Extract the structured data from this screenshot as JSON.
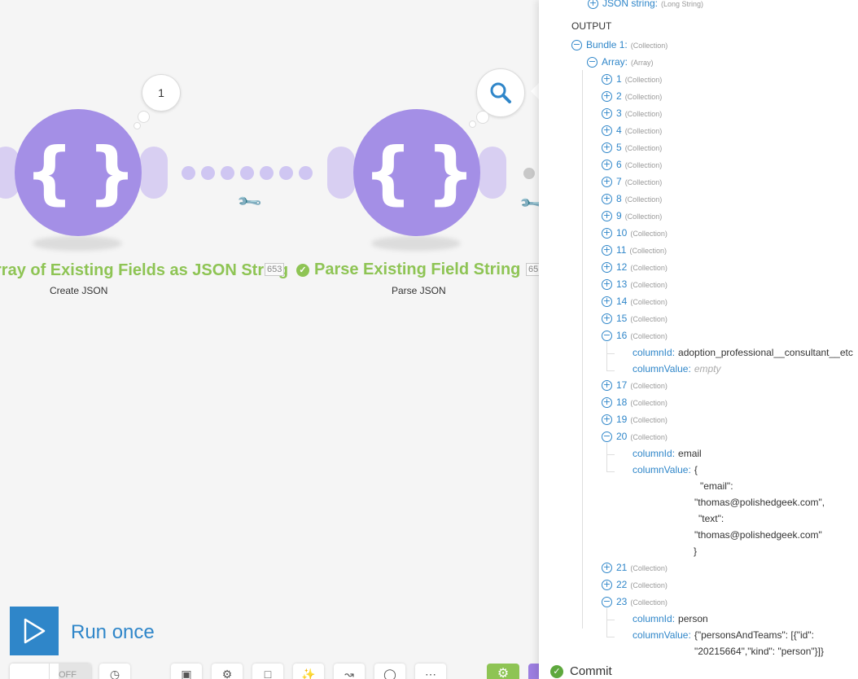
{
  "modules": [
    {
      "title": "rray of Existing Fields as JSON String",
      "subtitle": "Create JSON",
      "op_count": "653",
      "bubble": "1",
      "glyph": "{ }"
    },
    {
      "title": "Parse Existing Field String",
      "subtitle": "Parse JSON",
      "op_count": "65",
      "glyph": "{ }"
    }
  ],
  "toolbar": {
    "run_label": "Run once",
    "toggle_off": "OFF"
  },
  "inspector": {
    "input_last": {
      "key": "JSON string:",
      "type": "(Long String)"
    },
    "output_label": "OUTPUT",
    "bundle": {
      "key": "Bundle 1:",
      "type": "(Collection)"
    },
    "array": {
      "key": "Array:",
      "type": "(Array)"
    },
    "collection_type": "(Collection)",
    "items": [
      "1",
      "2",
      "3",
      "4",
      "5",
      "6",
      "7",
      "8",
      "9",
      "10",
      "11",
      "12",
      "13",
      "14",
      "15",
      "16",
      "17",
      "18",
      "19",
      "20",
      "21",
      "22",
      "23"
    ],
    "item16": {
      "key1": "columnId:",
      "val1": "adoption_professional__consultant__etc",
      "key2": "columnValue:",
      "val2": "empty"
    },
    "item20": {
      "key1": "columnId:",
      "val1": "email",
      "key2": "columnValue:",
      "val2": "{",
      "lines": [
        "\"email\":",
        "\"thomas@polishedgeek.com\",",
        "\"text\":",
        "\"thomas@polishedgeek.com\"",
        "}"
      ]
    },
    "item23": {
      "key1": "columnId:",
      "val1": "person",
      "key2": "columnValue:",
      "val2": "{\"personsAndTeams\": [{\"id\":",
      "line2": "\"20215664\",\"kind\": \"person\"}]}"
    },
    "commit_label": "Commit"
  },
  "colors": {
    "module": "#a48fe6",
    "accent": "#2f86c9",
    "success": "#8ec454"
  }
}
